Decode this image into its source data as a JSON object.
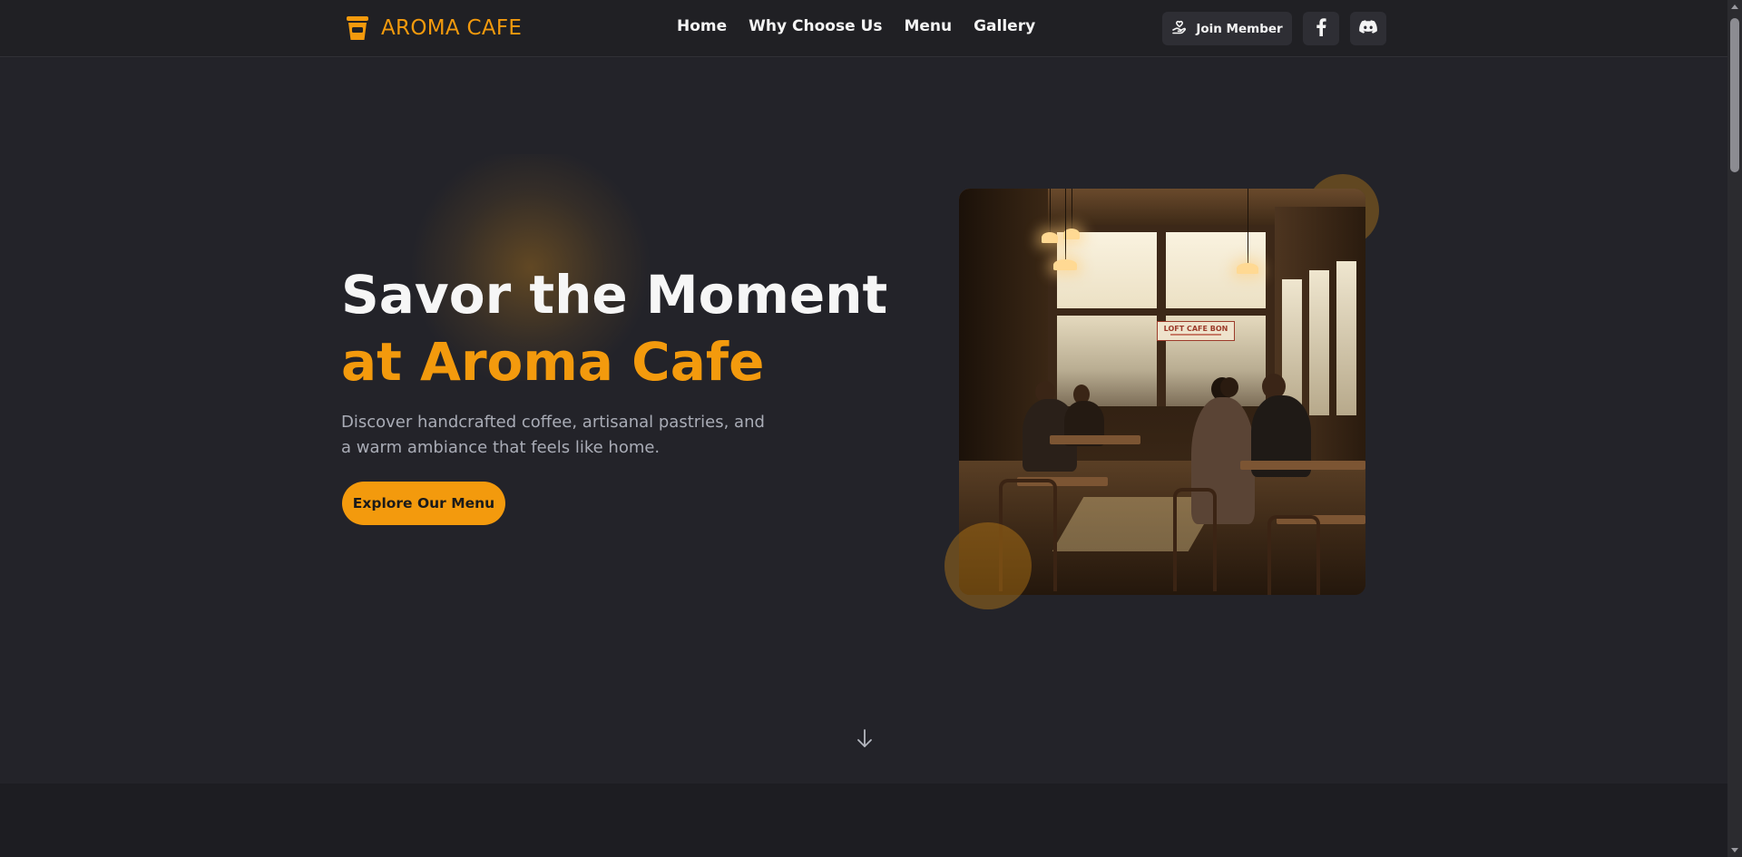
{
  "header": {
    "brand_name": "AROMA CAFE",
    "brand_icon": "coffee-cup-icon",
    "nav": [
      {
        "label": "Home"
      },
      {
        "label": "Why Choose Us"
      },
      {
        "label": "Menu"
      },
      {
        "label": "Gallery"
      }
    ],
    "join_label": "Join Member",
    "join_icon": "hand-heart-icon",
    "social": [
      {
        "icon": "facebook-icon"
      },
      {
        "icon": "discord-icon"
      }
    ]
  },
  "hero": {
    "title_line1": "Savor the Moment",
    "title_line2": "at Aroma Cafe",
    "subtitle": "Discover handcrafted coffee, artisanal pastries, and a warm ambiance that feels like home.",
    "cta_label": "Explore Our Menu",
    "image_sign_text": "LOFT CAFE BON",
    "scroll_icon": "arrow-down-icon"
  },
  "colors": {
    "accent": "#f39a0d",
    "background": "#232329",
    "header_bg": "#202024",
    "button_bg": "#2e2e34",
    "muted_text": "#a9acb6"
  }
}
